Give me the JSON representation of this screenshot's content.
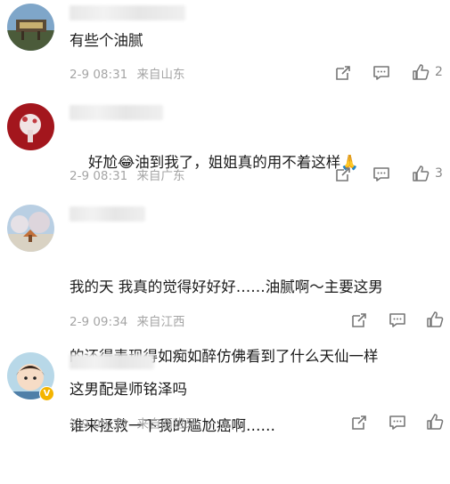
{
  "comments": [
    {
      "text": "有些个油腻",
      "time": "2-9 08:31",
      "location": "来自山东",
      "likes": "2",
      "icons": [
        "repost-icon",
        "comment-icon",
        "like-icon"
      ]
    },
    {
      "text_before": "好尬",
      "emoji_1": "😂",
      "text_after": "油到我了，姐姐真的用不着这样",
      "emoji_2": "🙏",
      "time": "2-9 08:31",
      "location": "来自广东",
      "likes": "3"
    },
    {
      "text_line1": "我的天 我真的觉得好好好……油腻啊～主要这男",
      "text_line2": "的还得表现得如痴如醉仿佛看到了什么天仙一样",
      "text_line3": "谁来拯救一下我的尴尬癌啊……",
      "time": "2-9 09:34",
      "location": "来自江西",
      "likes": ""
    },
    {
      "text": "这男配是师铭泽吗",
      "time": "2-9 09:33",
      "location": "来自西班牙",
      "likes": "",
      "verified_badge": "V"
    }
  ]
}
